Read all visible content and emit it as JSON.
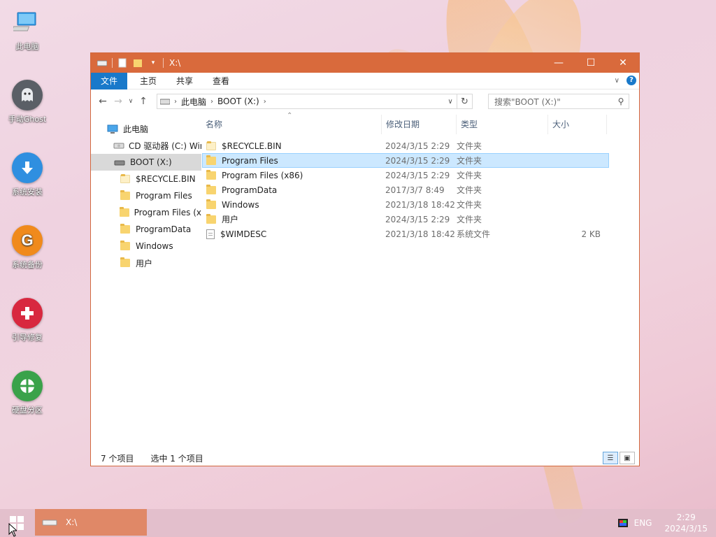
{
  "desktop": {
    "icons": [
      {
        "label": "此电脑"
      },
      {
        "label": "手动Ghost"
      },
      {
        "label": "系统安装"
      },
      {
        "label": "系统备份"
      },
      {
        "label": "引导修复"
      },
      {
        "label": "硬盘分区"
      }
    ]
  },
  "window": {
    "title": "X:\\",
    "ribbon_tabs": [
      "文件",
      "主页",
      "共享",
      "查看"
    ],
    "breadcrumb": [
      "此电脑",
      "BOOT (X:)"
    ],
    "search_placeholder": "搜索\"BOOT (X:)\"",
    "nav_tree": [
      {
        "label": "此电脑",
        "icon": "computer-icon"
      },
      {
        "label": "CD 驱动器 (C:) Wir",
        "icon": "cd-drive-icon"
      },
      {
        "label": "BOOT (X:)",
        "icon": "drive-icon",
        "selected": true
      },
      {
        "label": "$RECYCLE.BIN",
        "icon": "folder-icon"
      },
      {
        "label": "Program Files",
        "icon": "folder-icon"
      },
      {
        "label": "Program Files (x",
        "icon": "folder-icon"
      },
      {
        "label": "ProgramData",
        "icon": "folder-icon"
      },
      {
        "label": "Windows",
        "icon": "folder-icon"
      },
      {
        "label": "用户",
        "icon": "folder-icon"
      }
    ],
    "columns": {
      "name": "名称",
      "date": "修改日期",
      "type": "类型",
      "size": "大小"
    },
    "files": [
      {
        "name": "$RECYCLE.BIN",
        "date": "2024/3/15 2:29",
        "type": "文件夹",
        "size": "",
        "icon": "folder-icon"
      },
      {
        "name": "Program Files",
        "date": "2024/3/15 2:29",
        "type": "文件夹",
        "size": "",
        "icon": "folder-icon",
        "selected": true
      },
      {
        "name": "Program Files (x86)",
        "date": "2024/3/15 2:29",
        "type": "文件夹",
        "size": "",
        "icon": "folder-icon"
      },
      {
        "name": "ProgramData",
        "date": "2017/3/7 8:49",
        "type": "文件夹",
        "size": "",
        "icon": "folder-icon"
      },
      {
        "name": "Windows",
        "date": "2021/3/18 18:42",
        "type": "文件夹",
        "size": "",
        "icon": "folder-icon"
      },
      {
        "name": "用户",
        "date": "2024/3/15 2:29",
        "type": "文件夹",
        "size": "",
        "icon": "folder-icon"
      },
      {
        "name": "$WIMDESC",
        "date": "2021/3/18 18:42",
        "type": "系统文件",
        "size": "2 KB",
        "icon": "file-icon"
      }
    ],
    "status": {
      "item_count": "7 个项目",
      "selected": "选中 1 个项目"
    }
  },
  "taskbar": {
    "task_label": "X:\\",
    "language": "ENG",
    "time": "2:29",
    "date": "2024/3/15"
  },
  "colors": {
    "titlebar": "#d96a3c",
    "file_tab": "#1979ca",
    "selection": "#cce8ff",
    "taskbar_item": "#e08867"
  }
}
